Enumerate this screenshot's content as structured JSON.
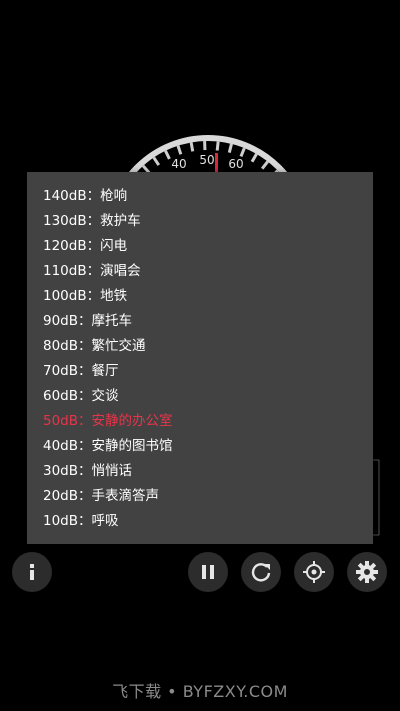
{
  "gauge": {
    "tick_labels": [
      "40",
      "50",
      "60"
    ],
    "needle_color": "#d62b3c"
  },
  "levels_popup": {
    "items": [
      {
        "text": "140dB：枪响"
      },
      {
        "text": "130dB：救护车"
      },
      {
        "text": "120dB：闪电"
      },
      {
        "text": "110dB：演唱会"
      },
      {
        "text": "100dB：地铁"
      },
      {
        "text": "90dB：摩托车"
      },
      {
        "text": "80dB：繁忙交通"
      },
      {
        "text": "70dB：餐厅"
      },
      {
        "text": "60dB：交谈"
      },
      {
        "text": "50dB：安静的办公室"
      },
      {
        "text": "40dB：安静的图书馆"
      },
      {
        "text": "30dB：悄悄话"
      },
      {
        "text": "20dB：手表滴答声"
      },
      {
        "text": "10dB：呼吸"
      }
    ],
    "active_index": 9,
    "active_color": "#e8344a"
  },
  "controls": {
    "info_icon": "info-icon",
    "pause_icon": "pause-icon",
    "reset_icon": "reset-icon",
    "calibrate_icon": "crosshair-icon",
    "settings_icon": "gear-icon"
  },
  "watermark": {
    "text": "飞下载 • BYFZXY.COM"
  }
}
